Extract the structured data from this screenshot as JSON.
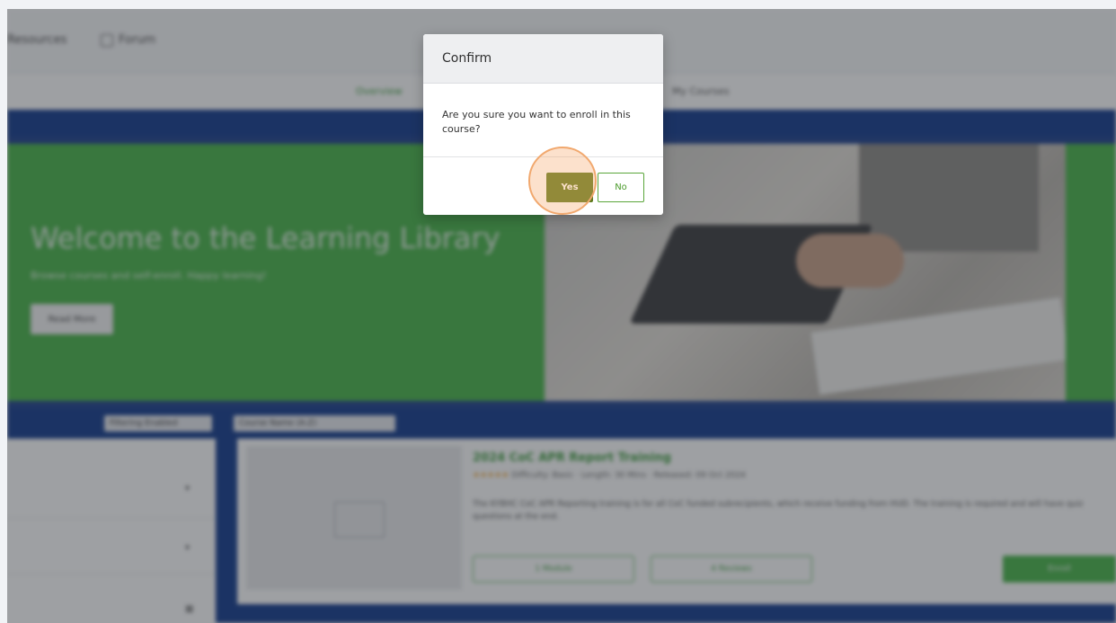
{
  "topnav": {
    "resources_label": "Resources",
    "forum_label": "Forum"
  },
  "subnav": {
    "tab_overview": "Overview",
    "tab_my_courses": "My Courses"
  },
  "hero": {
    "title": "Welcome to the Learning Library",
    "subtitle": "Browse courses and self-enroll. Happy learning!",
    "button_label": "Read More"
  },
  "filters": {
    "filter_label": "Filtering Enabled",
    "sort_label": "Course Name (A-Z)"
  },
  "course": {
    "title": "2024 CoC APR Report Training",
    "stars": "★★★★★",
    "meta": "Difficulty: Basic · Length: 30 Mins · Released: 09 Oct 2024",
    "description": "The KYBHC CoC APR Reporting training is for all CoC funded subrecipients, which receive funding from HUD. The training is required and will have quiz questions at the end.",
    "btn1_label": "1 Module",
    "btn2_label": "4 Reviews",
    "enroll_label": "Enroll"
  },
  "modal": {
    "title": "Confirm",
    "message": "Are you sure you want to enroll in this course?",
    "yes_label": "Yes",
    "no_label": "No"
  }
}
